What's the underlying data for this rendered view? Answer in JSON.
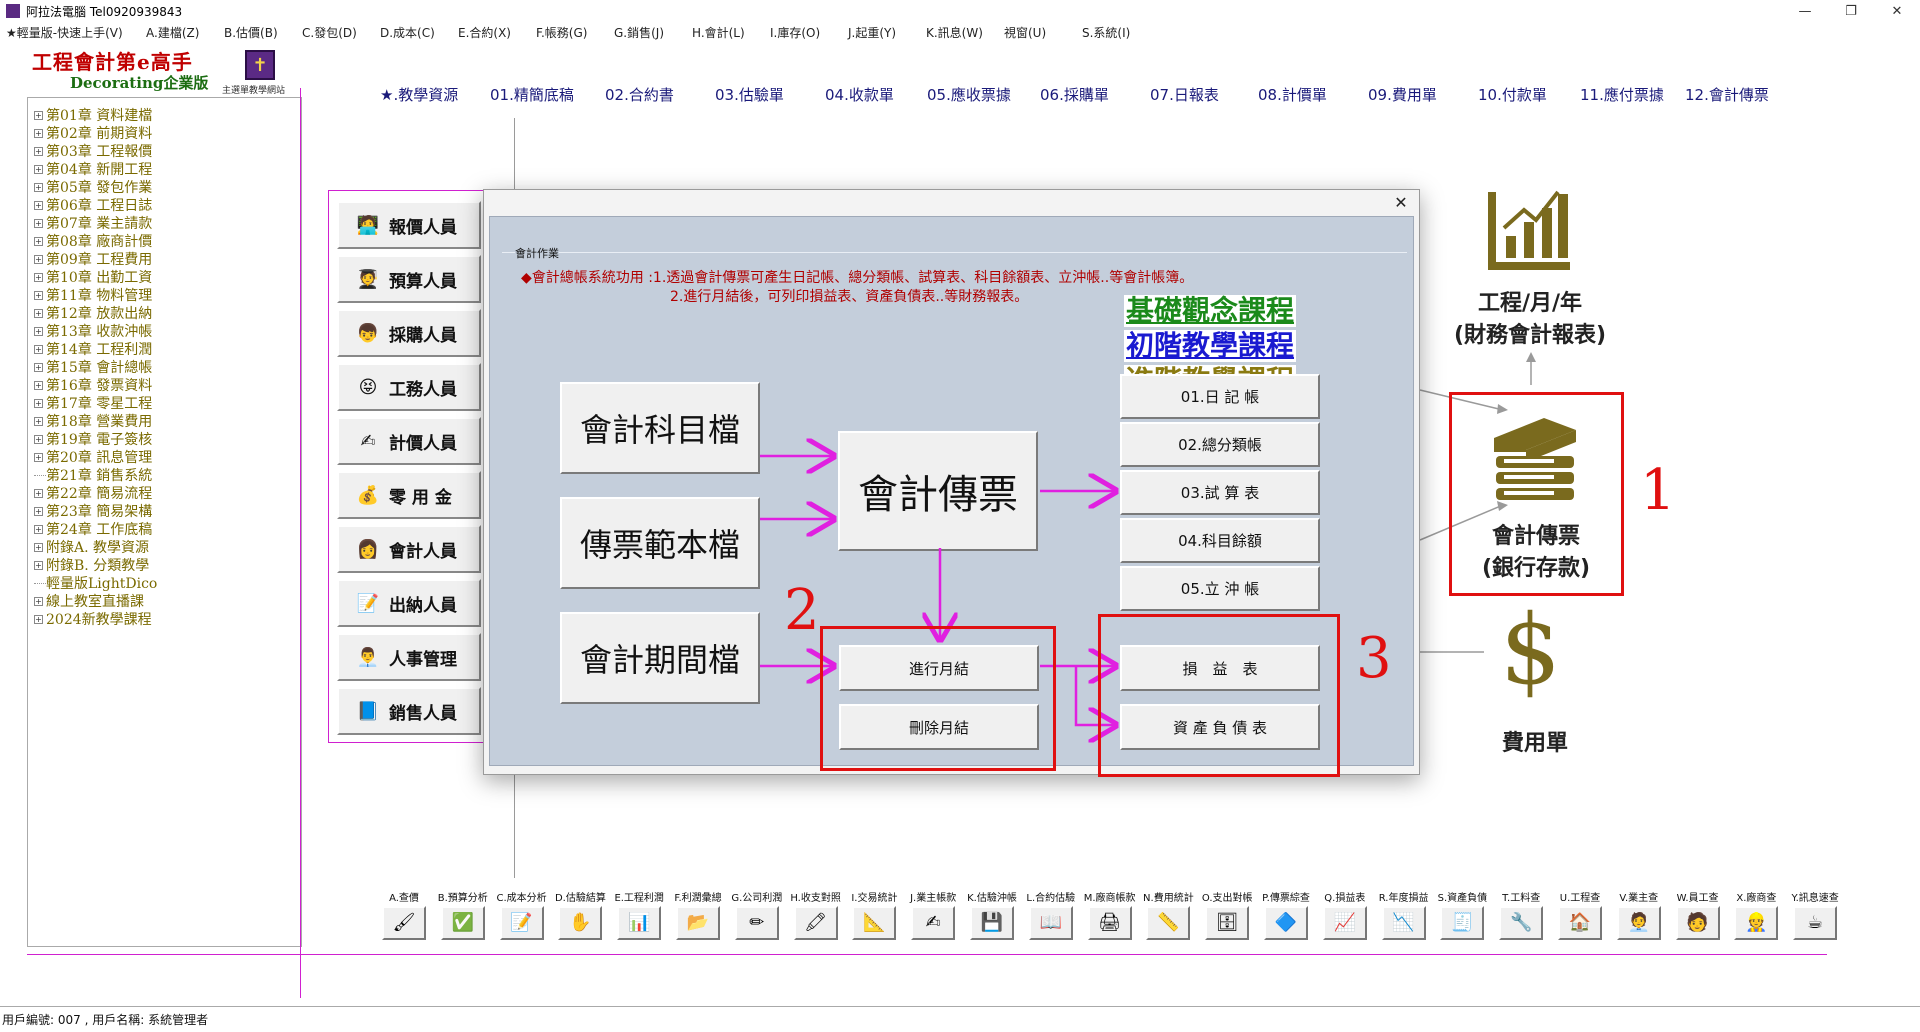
{
  "window": {
    "title": "阿拉法電腦 Tel0920939843",
    "controls": [
      "—",
      "❐",
      "✕"
    ]
  },
  "menu": [
    "★輕量版-快速上手(V)",
    "A.建檔(Z)",
    "B.估價(B)",
    "C.發包(D)",
    "D.成本(C)",
    "E.合約(X)",
    "F.帳務(G)",
    "G.銷售(J)",
    "H.會計(L)",
    "I.庫存(O)",
    "J.起重(Y)",
    "K.訊息(W)",
    "視窗(U)",
    "S.系統(I)"
  ],
  "brand": {
    "title": "工程會計第e高手",
    "subtitle": "Decorating企業版",
    "logo_caption": "主選單教學網站"
  },
  "tree": [
    "第01章 資料建檔",
    "第02章 前期資料",
    "第03章 工程報價",
    "第04章 新開工程",
    "第05章 發包作業",
    "第06章 工程日誌",
    "第07章 業主請款",
    "第08章 廠商計價",
    "第09章 工程費用",
    "第10章 出勤工資",
    "第11章 物料管理",
    "第12章 放款出納",
    "第13章 收款沖帳",
    "第14章 工程利潤",
    "第15章 會計總帳",
    "第16章 發票資料",
    "第17章 零星工程",
    "第18章 營業費用",
    "第19章 電子簽核",
    "第20章 訊息管理",
    "第21章 銷售系統",
    "第22章 簡易流程",
    "第23章 簡易架構",
    "第24章 工作底稿",
    "附錄A. 教學資源",
    "附錄B. 分類教學",
    "輕量版LightDico",
    "線上教室直播課",
    "2024新教學課程"
  ],
  "top_tabs": [
    "★.教學資源",
    "01.精簡底稿",
    "02.合約書",
    "03.估驗單",
    "04.收款單",
    "05.應收票據",
    "06.採購單",
    "07.日報表",
    "08.計價單",
    "09.費用單",
    "10.付款單",
    "11.應付票據",
    "12.會計傳票"
  ],
  "roles": [
    "報價人員",
    "預算人員",
    "採購人員",
    "工務人員",
    "計價人員",
    "零 用 金",
    "會計人員",
    "出納人員",
    "人事管理",
    "銷售人員"
  ],
  "right_panel": {
    "report_label_1": "工程/月/年",
    "report_label_2": "(財務會計報表)",
    "voucher_label_1": "會計傳票",
    "voucher_label_2": "(銀行存款)",
    "expense_label": "費用單",
    "icon_color": "#7a6a1e"
  },
  "annotations": {
    "n1": "1",
    "n2": "2",
    "n3": "3",
    "color": "#e01010"
  },
  "dialog": {
    "close": "✕",
    "group_title": "會計作業",
    "desc1": "◆會計總帳系統功用 :1.透過會計傳票可產生日記帳、總分類帳、試算表、科目餘額表、立沖帳..等會計帳簿。",
    "desc2": "2.進行月結後，可列印損益表、資產負債表..等財務報表。",
    "courses": [
      {
        "label": "基礎觀念課程",
        "color": "#1b8a1b"
      },
      {
        "label": "初階教學課程",
        "color": "#1a1ad0"
      },
      {
        "label": "進階教學課程",
        "color": "#8a7a10"
      }
    ],
    "left_files": [
      "會計科目檔",
      "傳票範本檔",
      "會計期間檔"
    ],
    "center": "會計傳票",
    "month_buttons": [
      "進行月結",
      "刪除月結"
    ],
    "ledgers": [
      "01.日 記 帳",
      "02.總分類帳",
      "03.試 算 表",
      "04.科目餘額",
      "05.立 沖 帳"
    ],
    "reports": [
      "損　益　表",
      "資 產 負 債 表"
    ],
    "arrow_color": "#e020e0"
  },
  "toolbar": [
    {
      "label": "A.查價",
      "icon": "🖌"
    },
    {
      "label": "B.預算分析",
      "icon": "✅"
    },
    {
      "label": "C.成本分析",
      "icon": "📝"
    },
    {
      "label": "D.估驗結算",
      "icon": "✋"
    },
    {
      "label": "E.工程利潤",
      "icon": "📊"
    },
    {
      "label": "F.利潤彙總",
      "icon": "📂"
    },
    {
      "label": "G.公司利潤",
      "icon": "✏"
    },
    {
      "label": "H.收支對照",
      "icon": "🖍"
    },
    {
      "label": "I.交易統計",
      "icon": "📐"
    },
    {
      "label": "J.業主帳款",
      "icon": "✍"
    },
    {
      "label": "K.估驗沖帳",
      "icon": "💾"
    },
    {
      "label": "L.合約估驗",
      "icon": "📖"
    },
    {
      "label": "M.廠商帳款",
      "icon": "🖨"
    },
    {
      "label": "N.費用統計",
      "icon": "📏"
    },
    {
      "label": "O.支出對帳",
      "icon": "🗄"
    },
    {
      "label": "P.傳票綜查",
      "icon": "🔷"
    },
    {
      "label": "Q.損益表",
      "icon": "📈"
    },
    {
      "label": "R.年度損益",
      "icon": "📉"
    },
    {
      "label": "S.資產負債",
      "icon": "🧾"
    },
    {
      "label": "T.工料查",
      "icon": "🔧"
    },
    {
      "label": "U.工程查",
      "icon": "🏠"
    },
    {
      "label": "V.業主查",
      "icon": "🧑‍💼"
    },
    {
      "label": "W.員工查",
      "icon": "🧑"
    },
    {
      "label": "X.廠商查",
      "icon": "👷"
    },
    {
      "label": "Y.訊息速查",
      "icon": "☕"
    }
  ],
  "status": "用戶編號: 007 , 用戶名稱: 系統管理者"
}
